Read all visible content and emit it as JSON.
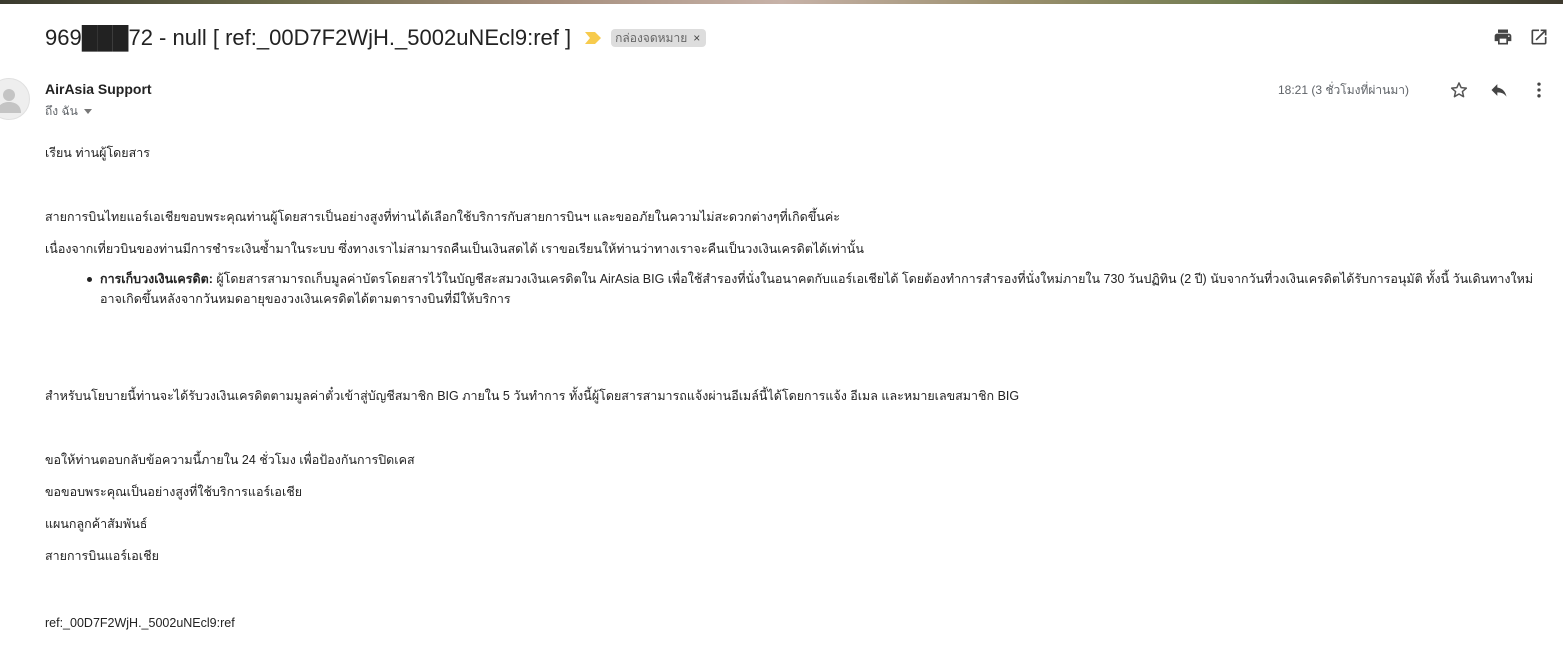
{
  "email": {
    "subject": "969███72 - null [ ref:_00D7F2WjH._5002uNEcl9:ref ]",
    "label": "กล่องจดหมาย",
    "label_close": "×",
    "sender": "AirAsia Support",
    "recipient": "ถึง ฉัน",
    "timestamp": "18:21 (3 ชั่วโมงที่ผ่านมา)",
    "colors": {
      "importance_marker": "#f7cb4d",
      "label_bg": "#dddddd",
      "icon": "#5f6368"
    },
    "icons": {
      "print": "print-icon",
      "open_new_window": "open-in-new-window-icon",
      "star": "star-icon",
      "reply": "reply-icon",
      "more": "more-vertical-icon",
      "importance": "importance-marker-icon",
      "avatar": "avatar-icon"
    }
  },
  "body": {
    "greeting": "เรียน ท่านผู้โดยสาร",
    "para1": "สายการบินไทยแอร์เอเชียขอบพระคุณท่านผู้โดยสารเป็นอย่างสูงที่ท่านได้เลือกใช้บริการกับสายการบินฯ และขออภัยในความไม่สะดวกต่างๆที่เกิดขึ้นค่ะ",
    "para2": "เนื่องจากเที่ยวบินของท่านมีการชำระเงินซ้ำมาในระบบ ซึ่งทางเราไม่สามารถคืนเป็นเงินสดได้ เราขอเรียนให้ท่านว่าทางเราจะคืนเป็นวงเงินเครดิตได้เท่านั้น",
    "bullet_title": "การเก็บวงเงินเครดิต:",
    "bullet_text": " ผู้โดยสารสามารถเก็บมูลค่าบัตรโดยสารไว้ในบัญชีสะสมวงเงินเครดิตใน AirAsia BIG เพื่อใช้สำรองที่นั่งในอนาคตกับแอร์เอเชียได้ โดยต้องทำการสำรองที่นั่งใหม่ภายใน 730 วันปฏิทิน (2 ปี) นับจากวันที่วงเงินเครดิตได้รับการอนุมัติ ทั้งนี้ วันเดินทางใหม่อาจเกิดขึ้นหลังจากวันหมดอายุของวงเงินเครดิตได้ตามตารางบินที่มีให้บริการ",
    "para3": "สำหรับนโยบายนี้ท่านจะได้รับวงเงินเครดิตตามมูลค่าตั๋วเข้าสู่บัญชีสมาชิก BIG ภายใน 5 วันทำการ ทั้งนี้ผู้โดยสารสามารถแจ้งผ่านอีเมล์นี้ได้โดยการแจ้ง อีเมล และหมายเลขสมาชิก BIG",
    "para4": "ขอให้ท่านตอบกลับข้อความนี้ภายใน 24 ชั่วโมง เพื่อป้องกันการปิดเคส",
    "thanks": "ขอขอบพระคุณเป็นอย่างสูงที่ใช้บริการแอร์เอเชีย",
    "dept": "แผนกลูกค้าสัมพันธ์",
    "airline": "สายการบินแอร์เอเชีย",
    "ref": "ref:_00D7F2WjH._5002uNEcl9:ref"
  }
}
